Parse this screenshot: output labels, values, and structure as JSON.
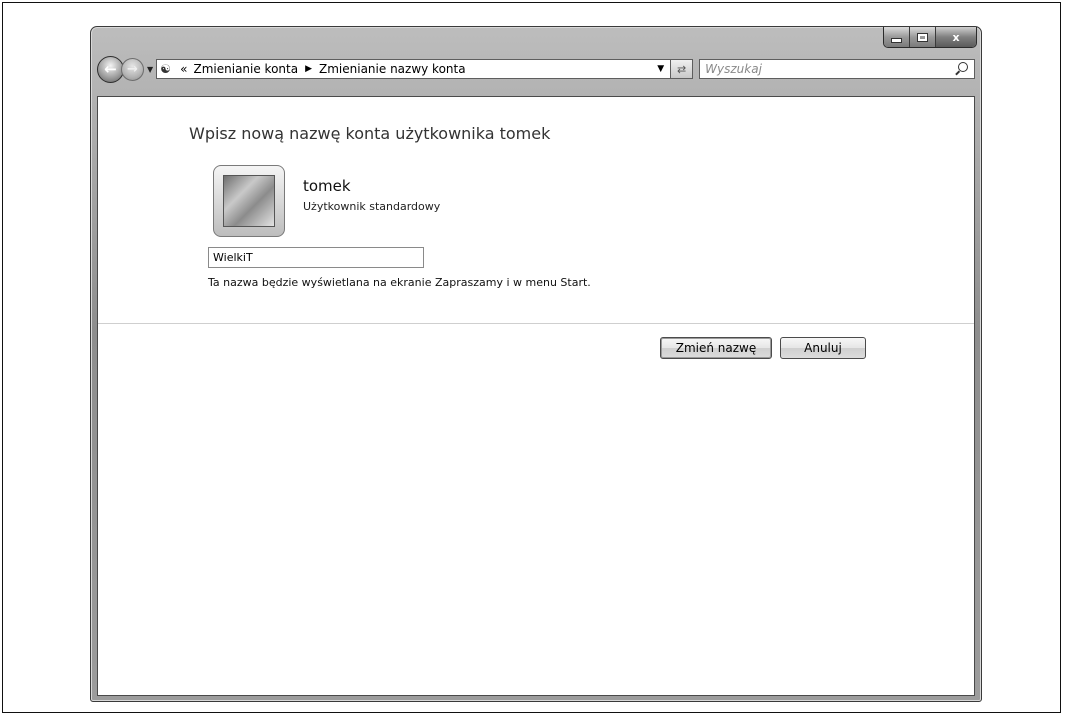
{
  "window": {
    "buttons": {
      "minimize": "minimize",
      "maximize": "maximize",
      "close": "x"
    }
  },
  "navigation": {
    "breadcrumb_chevron": "«",
    "breadcrumb": [
      "Zmienianie konta",
      "Zmienianie nazwy konta"
    ],
    "search_placeholder": "Wyszukaj"
  },
  "main": {
    "heading": "Wpisz nową nazwę konta użytkownika tomek",
    "user": {
      "name": "tomek",
      "type": "Użytkownik standardowy"
    },
    "name_input_value": "WielkiT",
    "hint": "Ta nazwa będzie wyświetlana na ekranie Zapraszamy i w menu Start.",
    "buttons": {
      "rename": "Zmień nazwę",
      "cancel": "Anuluj"
    }
  }
}
